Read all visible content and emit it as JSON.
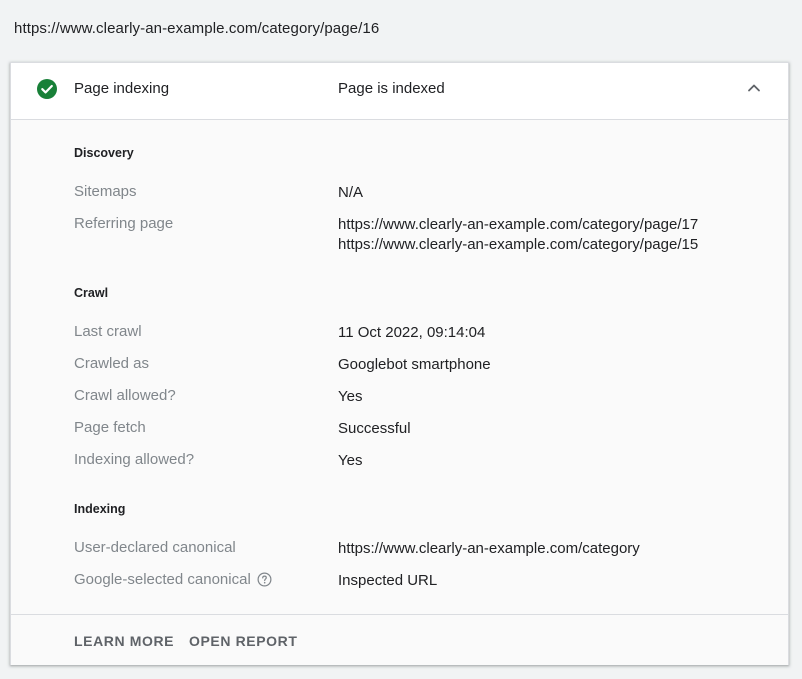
{
  "url": "https://www.clearly-an-example.com/category/page/16",
  "header": {
    "title": "Page indexing",
    "status": "Page is indexed",
    "status_color": "#188038"
  },
  "discovery": {
    "title": "Discovery",
    "sitemaps_label": "Sitemaps",
    "sitemaps_value": "N/A",
    "referring_label": "Referring page",
    "referring_values": [
      "https://www.clearly-an-example.com/category/page/17",
      "https://www.clearly-an-example.com/category/page/15"
    ]
  },
  "crawl": {
    "title": "Crawl",
    "rows": [
      {
        "label": "Last crawl",
        "value": "11 Oct 2022, 09:14:04"
      },
      {
        "label": "Crawled as",
        "value": "Googlebot smartphone"
      },
      {
        "label": "Crawl allowed?",
        "value": "Yes"
      },
      {
        "label": "Page fetch",
        "value": "Successful"
      },
      {
        "label": "Indexing allowed?",
        "value": "Yes"
      }
    ]
  },
  "indexing": {
    "title": "Indexing",
    "rows": [
      {
        "label": "User-declared canonical",
        "value": "https://www.clearly-an-example.com/category"
      },
      {
        "label": "Google-selected canonical",
        "value": "Inspected URL"
      }
    ]
  },
  "footer": {
    "learn_more": "LEARN MORE",
    "open_report": "OPEN REPORT"
  }
}
